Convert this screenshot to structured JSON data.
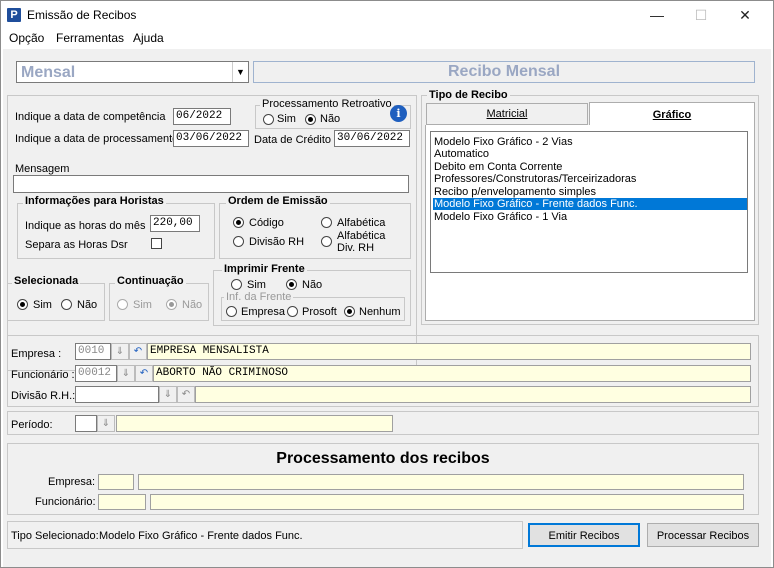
{
  "window": {
    "title": "Emissão de Recibos",
    "app_icon": "P",
    "minimize": "—",
    "maximize": "☐",
    "close": "✕"
  },
  "menu": [
    "Opção",
    "Ferramentas",
    "Ajuda"
  ],
  "top": {
    "combo_value": "Mensal",
    "combo_arrow": "▼",
    "header_title": "Recibo Mensal"
  },
  "dates": {
    "competencia_label": "Indique a data de competência",
    "competencia_value": "06/2022",
    "processamento_label": "Indique a data de processamento",
    "processamento_value": "03/06/2022",
    "credito_label": "Data de Crédito",
    "credito_value": "30/06/2022"
  },
  "retroativo": {
    "title": "Processamento Retroativo",
    "sim": "Sim",
    "nao": "Não",
    "selected": "nao",
    "info_icon": "i"
  },
  "mensagem": {
    "label": "Mensagem",
    "value": ""
  },
  "horistas": {
    "title": "Informações para Horistas",
    "horas_label": "Indique as horas do mês",
    "horas_value": "220,00",
    "dsr_label": "Separa as Horas Dsr"
  },
  "ordem": {
    "title": "Ordem de Emissão",
    "codigo": "Código",
    "alfabetica": "Alfabética",
    "divisao": "Divisão RH",
    "alfa_div_1": "Alfabética",
    "alfa_div_2": "Div.  RH"
  },
  "tipo_recibo": {
    "title": "Tipo de Recibo",
    "tab_matricial": "Matricial",
    "tab_grafico": "Gráfico",
    "items": [
      "Modelo Fixo Gráfico - 2 Vias",
      "Automatico",
      "Debito em Conta Corrente",
      "Professores/Construtoras/Terceirizadoras",
      "Recibo p/envelopamento simples",
      "Modelo Fixo Gráfico - Frente dados Func.",
      "Modelo Fixo Gráfico - 1 Via"
    ],
    "selected_index": 5
  },
  "selecionada": {
    "title": "Selecionada",
    "sim": "Sim",
    "nao": "Não"
  },
  "continuacao": {
    "title": "Continuação",
    "sim": "Sim",
    "nao": "Não"
  },
  "imprimir": {
    "title": "Imprimir Frente",
    "sim": "Sim",
    "nao": "Não",
    "inf_title": "Inf. da Frente",
    "empresa": "Empresa",
    "prosoft": "Prosoft",
    "nenhum": "Nenhum"
  },
  "filtros": {
    "empresa_label": "Empresa :",
    "empresa_code": "0010",
    "empresa_name": "EMPRESA MENSALISTA",
    "funcionario_label": "Funcionário :",
    "funcionario_code": "00012",
    "funcionario_name": "ABORTO NÃO CRIMINOSO",
    "divisao_label": "Divisão R.H.:",
    "periodo_label": "Período:",
    "lookup_icon": "⇓",
    "undo_icon": "↶"
  },
  "processamento": {
    "title": "Processamento dos recibos",
    "empresa_label": "Empresa:",
    "funcionario_label": "Funcionário:"
  },
  "footer": {
    "tipo_label": "Tipo Selecionado:",
    "tipo_value": "Modelo Fixo Gráfico - Frente dados Func.",
    "emitir_label": "Emitir Recibos",
    "processar_label": "Processar Recibos"
  }
}
